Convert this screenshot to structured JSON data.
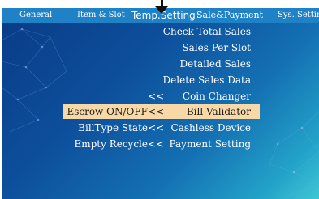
{
  "tabs": [
    {
      "label": "General"
    },
    {
      "label": "Item & Slot"
    },
    {
      "label": "Temp.Setting"
    },
    {
      "label": "Sale&Payment"
    },
    {
      "label": "Sys. Setting"
    }
  ],
  "menu": {
    "chevron": "<<",
    "items": [
      {
        "left": "",
        "chevron": "",
        "right": "Check Total Sales"
      },
      {
        "left": "",
        "chevron": "",
        "right": "Sales Per Slot"
      },
      {
        "left": "",
        "chevron": "",
        "right": "Detailed Sales"
      },
      {
        "left": "",
        "chevron": "",
        "right": "Delete Sales Data"
      },
      {
        "left": "",
        "chevron": "<<",
        "right": "Coin Changer"
      },
      {
        "left": "Escrow ON/OFF",
        "chevron": "<<",
        "right": "Bill Validator"
      },
      {
        "left": "BillType State",
        "chevron": "<<",
        "right": "Cashless Device"
      },
      {
        "left": "Empty Recycle",
        "chevron": "<<",
        "right": "Payment Setting"
      }
    ]
  },
  "colors": {
    "tab_bar": "#1f82c6",
    "panel_top": "#0a3c87",
    "panel_bottom": "#3fc7d4",
    "selected_row": "#f7d8a6"
  }
}
